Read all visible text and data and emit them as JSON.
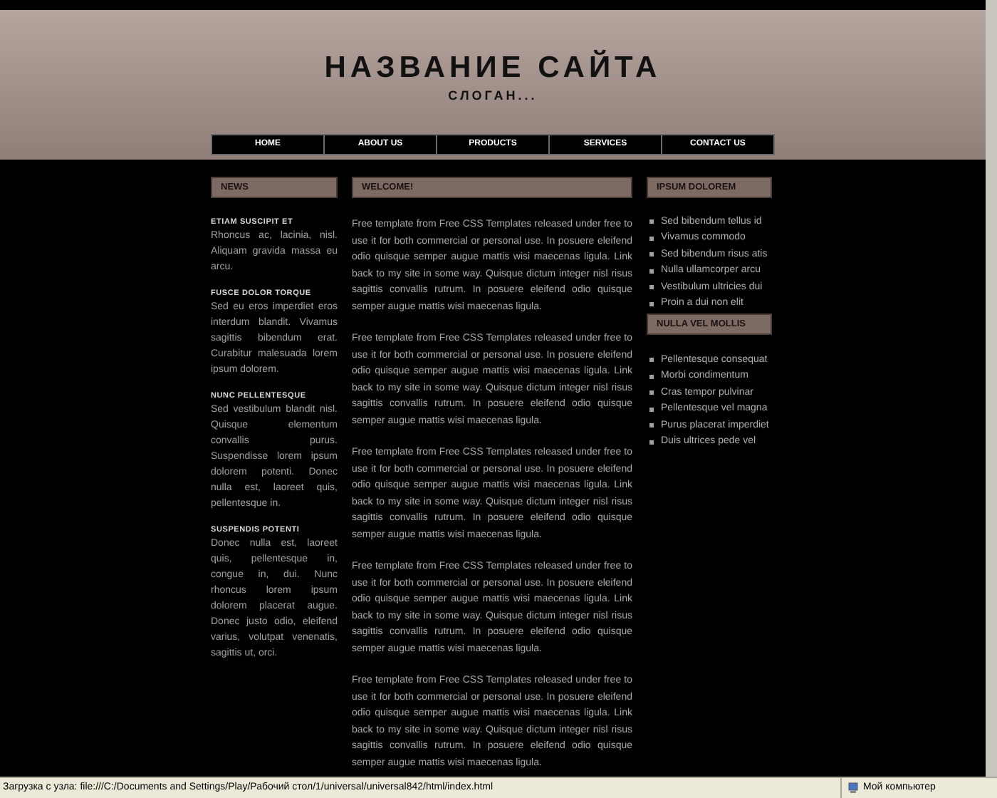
{
  "header": {
    "site_title": "НАЗВАНИЕ САЙТА",
    "slogan": "СЛОГАН..."
  },
  "nav": [
    {
      "label": "HOME"
    },
    {
      "label": "ABOUT US"
    },
    {
      "label": "PRODUCTS"
    },
    {
      "label": "SERVICES"
    },
    {
      "label": "CONTACT US"
    }
  ],
  "news": {
    "heading": "NEWS",
    "items": [
      {
        "title": "ETIAM SUSCIPIT ET",
        "text": "Rhoncus ac, lacinia, nisl. Aliquam gravida massa eu arcu."
      },
      {
        "title": "FUSCE DOLOR TORQUE",
        "text": "Sed eu eros imperdiet eros interdum blandit. Vivamus sagittis bibendum erat. Curabitur malesuada lorem ipsum dolorem."
      },
      {
        "title": "NUNC PELLENTESQUE",
        "text": "Sed vestibulum blandit nisl. Quisque elementum convallis purus. Suspendisse lorem ipsum dolorem potenti. Donec nulla est, laoreet quis, pellentesque in."
      },
      {
        "title": "SUSPENDIS POTENTI",
        "text": "Donec nulla est, laoreet quis, pellentesque in, congue in, dui. Nunc rhoncus lorem ipsum dolorem placerat augue. Donec justo odio, eleifend varius, volutpat venenatis, sagittis ut, orci."
      }
    ]
  },
  "welcome": {
    "heading": "WELCOME!",
    "paragraphs": [
      "Free template from Free CSS Templates released under free to use it for both commercial or personal use. In posuere eleifend odio quisque semper augue mattis wisi maecenas ligula. Link back to my site in some way. Quisque dictum integer nisl risus sagittis convallis rutrum. In posuere eleifend odio quisque semper augue mattis wisi maecenas ligula.",
      "Free template from Free CSS Templates released under free to use it for both commercial or personal use. In posuere eleifend odio quisque semper augue mattis wisi maecenas ligula. Link back to my site in some way. Quisque dictum integer nisl risus sagittis convallis rutrum. In posuere eleifend odio quisque semper augue mattis wisi maecenas ligula.",
      "Free template from Free CSS Templates released under free to use it for both commercial or personal use. In posuere eleifend odio quisque semper augue mattis wisi maecenas ligula. Link back to my site in some way. Quisque dictum integer nisl risus sagittis convallis rutrum. In posuere eleifend odio quisque semper augue mattis wisi maecenas ligula.",
      "Free template from Free CSS Templates released under free to use it for both commercial or personal use. In posuere eleifend odio quisque semper augue mattis wisi maecenas ligula. Link back to my site in some way. Quisque dictum integer nisl risus sagittis convallis rutrum. In posuere eleifend odio quisque semper augue mattis wisi maecenas ligula.",
      "Free template from Free CSS Templates released under free to use it for both commercial or personal use. In posuere eleifend odio quisque semper augue mattis wisi maecenas ligula. Link back to my site in some way. Quisque dictum integer nisl risus sagittis convallis rutrum. In posuere eleifend odio quisque semper augue mattis wisi maecenas ligula."
    ]
  },
  "sidebar": [
    {
      "heading": "IPSUM DOLOREM",
      "items": [
        "Sed bibendum tellus id",
        "Vivamus commodo",
        "Sed bibendum risus atis",
        "Nulla ullamcorper arcu",
        "Vestibulum ultricies dui",
        "Proin a dui non elit"
      ]
    },
    {
      "heading": "NULLA VEL MOLLIS",
      "items": [
        "Pellentesque consequat",
        "Morbi condimentum",
        "Cras tempor pulvinar",
        "Pellentesque vel magna",
        "Purus placerat imperdiet",
        "Duis ultrices pede vel"
      ]
    }
  ],
  "status_bar": {
    "text": "Загрузка с узла: file:///C:/Documents and Settings/Play/Рабочий стол/1/universal/universal842/html/index.html",
    "zone": "Мой компьютер"
  }
}
